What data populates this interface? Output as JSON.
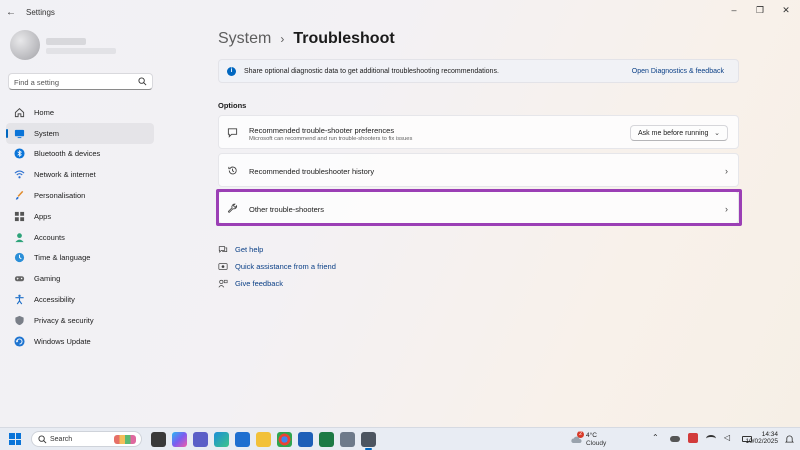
{
  "window": {
    "title": "Settings",
    "back_icon": "back-arrow-icon",
    "controls": [
      "minimize",
      "maximize",
      "close"
    ]
  },
  "sidebar": {
    "search_placeholder": "Find a setting",
    "items": [
      {
        "label": "Home",
        "icon": "home-icon",
        "active": false
      },
      {
        "label": "System",
        "icon": "system-icon",
        "active": true
      },
      {
        "label": "Bluetooth & devices",
        "icon": "bluetooth-icon",
        "active": false
      },
      {
        "label": "Network & internet",
        "icon": "wifi-icon",
        "active": false
      },
      {
        "label": "Personalisation",
        "icon": "brush-icon",
        "active": false
      },
      {
        "label": "Apps",
        "icon": "apps-icon",
        "active": false
      },
      {
        "label": "Accounts",
        "icon": "accounts-icon",
        "active": false
      },
      {
        "label": "Time & language",
        "icon": "globe-clock-icon",
        "active": false
      },
      {
        "label": "Gaming",
        "icon": "gamepad-icon",
        "active": false
      },
      {
        "label": "Accessibility",
        "icon": "accessibility-icon",
        "active": false
      },
      {
        "label": "Privacy & security",
        "icon": "shield-icon",
        "active": false
      },
      {
        "label": "Windows Update",
        "icon": "update-icon",
        "active": false
      }
    ]
  },
  "main": {
    "breadcrumb": {
      "parent": "System",
      "separator": "›",
      "current": "Troubleshoot"
    },
    "info_bar": {
      "text": "Share optional diagnostic data to get additional troubleshooting recommendations.",
      "link": "Open Diagnostics & feedback"
    },
    "section_title": "Options",
    "cards": {
      "preferences": {
        "title": "Recommended trouble-shooter preferences",
        "subtitle": "Microsoft can recommend and run trouble-shooters to fix issues",
        "dropdown_value": "Ask me before running"
      },
      "history": {
        "title": "Recommended troubleshooter history"
      },
      "other": {
        "title": "Other trouble-shooters",
        "highlighted": true
      }
    },
    "help_links": [
      {
        "label": "Get help",
        "icon": "help-icon"
      },
      {
        "label": "Quick assistance from a friend",
        "icon": "quick-assist-icon"
      },
      {
        "label": "Give feedback",
        "icon": "feedback-icon"
      }
    ]
  },
  "taskbar": {
    "search_label": "Search",
    "weather": {
      "temp": "4°C",
      "condition": "Cloudy",
      "badge": "2"
    },
    "clock": {
      "time": "14:34",
      "date": "10/02/2025"
    }
  },
  "colors": {
    "accent": "#0067c0",
    "highlight": "#9b3fb5",
    "link": "#0a3f86"
  }
}
